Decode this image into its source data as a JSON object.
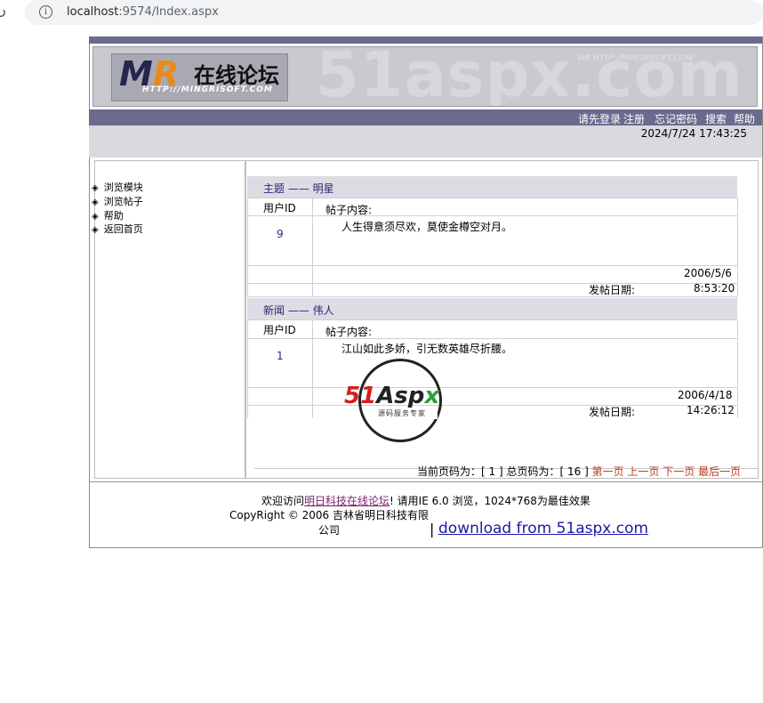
{
  "browser": {
    "url_host": "localhost",
    "url_path": ":9574/Index.aspx"
  },
  "banner": {
    "logo_mr": "MR",
    "logo_cn": "在线论坛",
    "logo_sub": "HTTP://MINGRISOFT.COM",
    "watermark": "51aspx.com",
    "watermark_small": "MR HTTP://MINGRISOFT.COM"
  },
  "nav": {
    "items": [
      "请先登录",
      "注册",
      "忘记密码",
      "搜索",
      "帮助"
    ]
  },
  "datetime": "2024/7/24 17:43:25",
  "sidebar": {
    "items": [
      "浏览模块",
      "浏览帖子",
      "帮助",
      "返回首页"
    ]
  },
  "posts": [
    {
      "module": "主题",
      "sep": "——",
      "title": "明星",
      "user_id_label": "用户ID",
      "content_label": "帖子内容:",
      "user_id": "9",
      "content": "人生得意须尽欢，莫使金樽空对月。",
      "date": "2006/5/6",
      "post_date_label": "发帖日期:",
      "time": "8:53:20"
    },
    {
      "module": "新闻",
      "sep": "——",
      "title": "伟人",
      "user_id_label": "用户ID",
      "content_label": "帖子内容:",
      "user_id": "1",
      "content": "江山如此多娇，引无数英雄尽折腰。",
      "date": "2006/4/18",
      "post_date_label": "发帖日期:",
      "time": "14:26:12"
    }
  ],
  "pager": {
    "current_label": "当前页码为：",
    "current": "[ 1 ]",
    "total_label": "总页码为：",
    "total": "[ 16 ]",
    "first": "第一页",
    "prev": "上一页",
    "next": "下一页",
    "last": "最后一页"
  },
  "footer": {
    "welcome_pre": "欢迎访问",
    "welcome_link": "明日科技在线论坛",
    "welcome_post": "! 请用IE 6.0 浏览，1024*768为最佳效果",
    "copyright": "CopyRight © 2006 吉林省明日科技有限公司",
    "separator": "|",
    "download": "download from 51aspx.com"
  },
  "watermark51": {
    "num": "51",
    "aspx": "Asp",
    "x": "x",
    "tagline": "源码服务专家"
  }
}
